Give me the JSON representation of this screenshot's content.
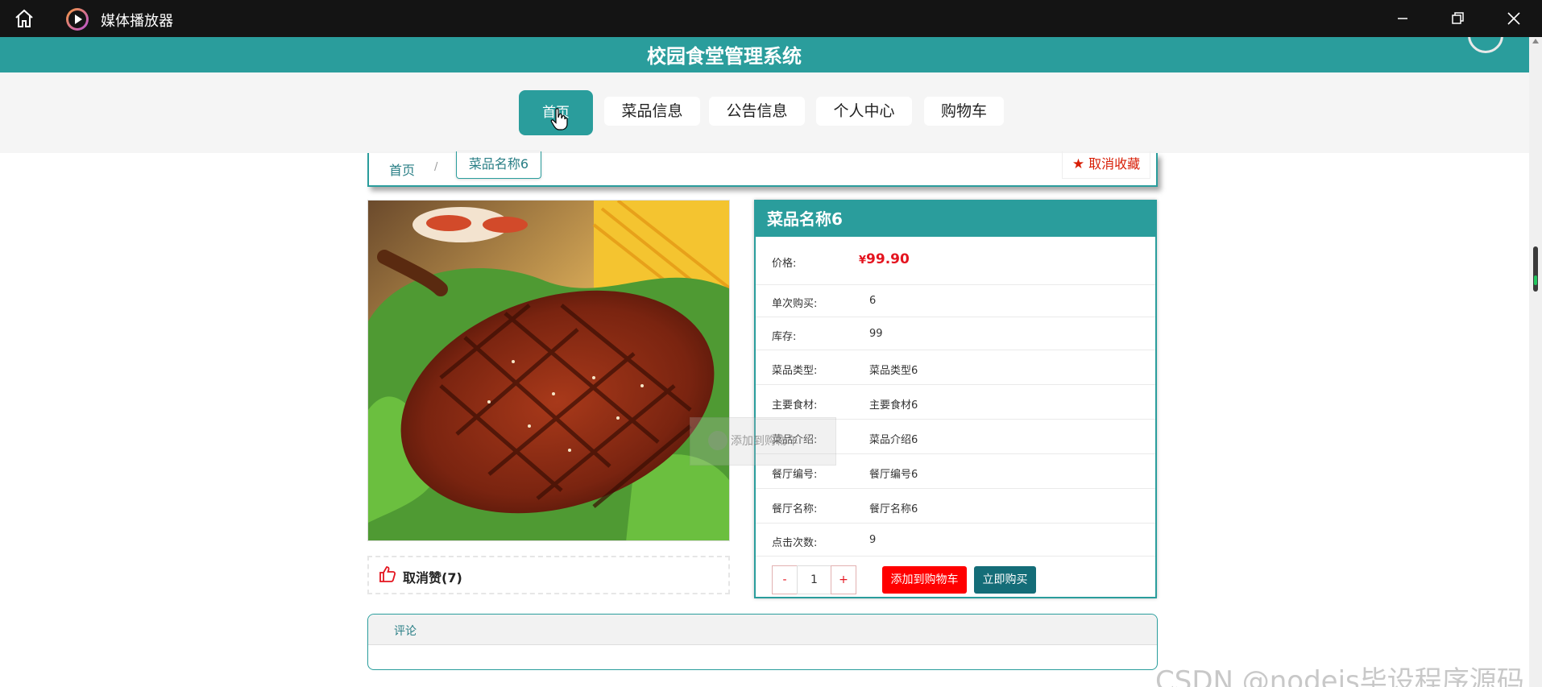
{
  "window": {
    "title": "媒体播放器"
  },
  "site": {
    "title": "校园食堂管理系统"
  },
  "nav": {
    "items": [
      {
        "label": "首页"
      },
      {
        "label": "菜品信息"
      },
      {
        "label": "公告信息"
      },
      {
        "label": "个人中心"
      },
      {
        "label": "购物车"
      }
    ],
    "active_index": 0
  },
  "breadcrumb": {
    "home": "首页",
    "separator": "/",
    "current": "菜品名称6"
  },
  "favorite": {
    "label": "取消收藏"
  },
  "product": {
    "name": "菜品名称6",
    "price_currency": "¥",
    "price_value": "99.90",
    "rows": [
      {
        "label": "价格:"
      },
      {
        "label": "单次购买:",
        "value": "6"
      },
      {
        "label": "库存:",
        "value": "99"
      },
      {
        "label": "菜品类型:",
        "value": "菜品类型6"
      },
      {
        "label": "主要食材:",
        "value": "主要食材6"
      },
      {
        "label": "菜品介绍:",
        "value": "菜品介绍6"
      },
      {
        "label": "餐厅编号:",
        "value": "餐厅编号6"
      },
      {
        "label": "餐厅名称:",
        "value": "餐厅名称6"
      },
      {
        "label": "点击次数:",
        "value": "9"
      }
    ],
    "quantity": {
      "minus": "-",
      "value": "1",
      "plus": "+"
    },
    "add_to_cart": "添加到购物车",
    "buy_now": "立即购买",
    "ghost_hint": "添加到购物车"
  },
  "like": {
    "label": "取消赞(7)"
  },
  "comments": {
    "label": "评论"
  },
  "watermark": "CSDN @nodejs毕设程序源码",
  "colors": {
    "brand": "#2a9d9c",
    "price": "#e4141f",
    "cart_button": "#ff0000",
    "buy_button": "#146d78"
  }
}
